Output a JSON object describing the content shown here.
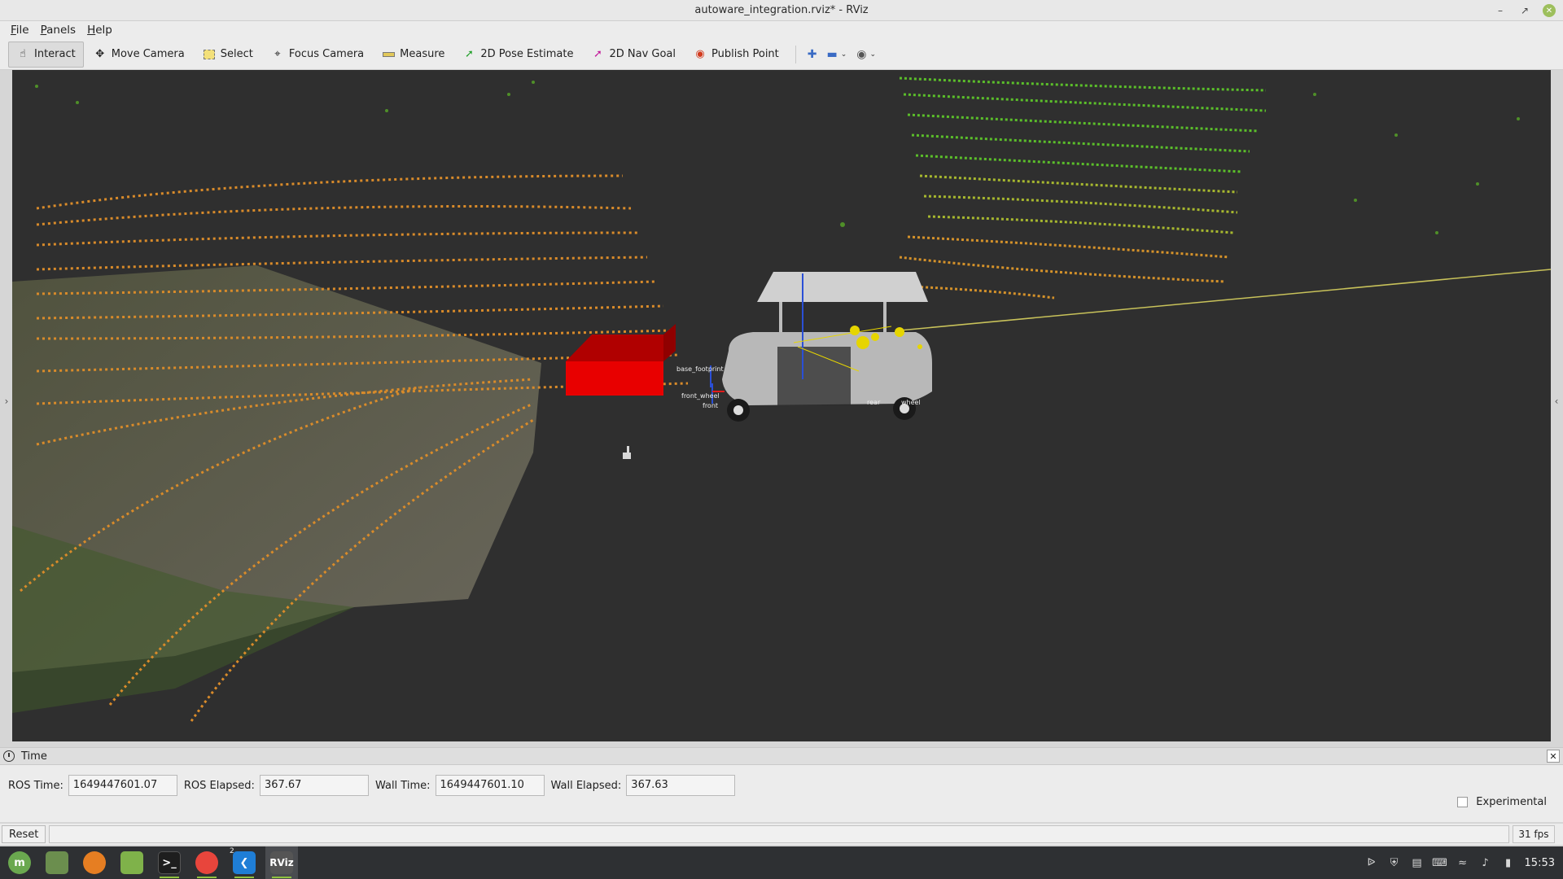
{
  "window": {
    "title": "autoware_integration.rviz* - RViz"
  },
  "menu": [
    "File",
    "Panels",
    "Help"
  ],
  "toolbar": {
    "interact": "Interact",
    "move_camera": "Move Camera",
    "select": "Select",
    "focus_camera": "Focus Camera",
    "measure": "Measure",
    "pose_estimate": "2D Pose Estimate",
    "nav_goal": "2D Nav Goal",
    "publish_point": "Publish Point"
  },
  "viewport": {
    "frame_labels": [
      "base_footprint",
      "front_wheel",
      "front",
      "rear",
      "wheel"
    ],
    "icons": [
      "golf-cart-model",
      "red-obstacle-box",
      "lidar-point-cloud"
    ]
  },
  "time_panel": {
    "title": "Time",
    "ros_time_label": "ROS Time:",
    "ros_time": "1649447601.07",
    "ros_elapsed_label": "ROS Elapsed:",
    "ros_elapsed": "367.67",
    "wall_time_label": "Wall Time:",
    "wall_time": "1649447601.10",
    "wall_elapsed_label": "Wall Elapsed:",
    "wall_elapsed": "367.63",
    "experimental_label": "Experimental"
  },
  "status": {
    "reset_label": "Reset",
    "fps": "31 fps"
  },
  "taskbar": {
    "clock": "15:53",
    "rviz_label": "RViz",
    "vscode_badge": "2"
  },
  "colors": {
    "viewport_bg": "#2f2f2f",
    "obstacle": "#e80000",
    "taskbar": "#2e3033",
    "accent_green": "#8fc23f"
  }
}
